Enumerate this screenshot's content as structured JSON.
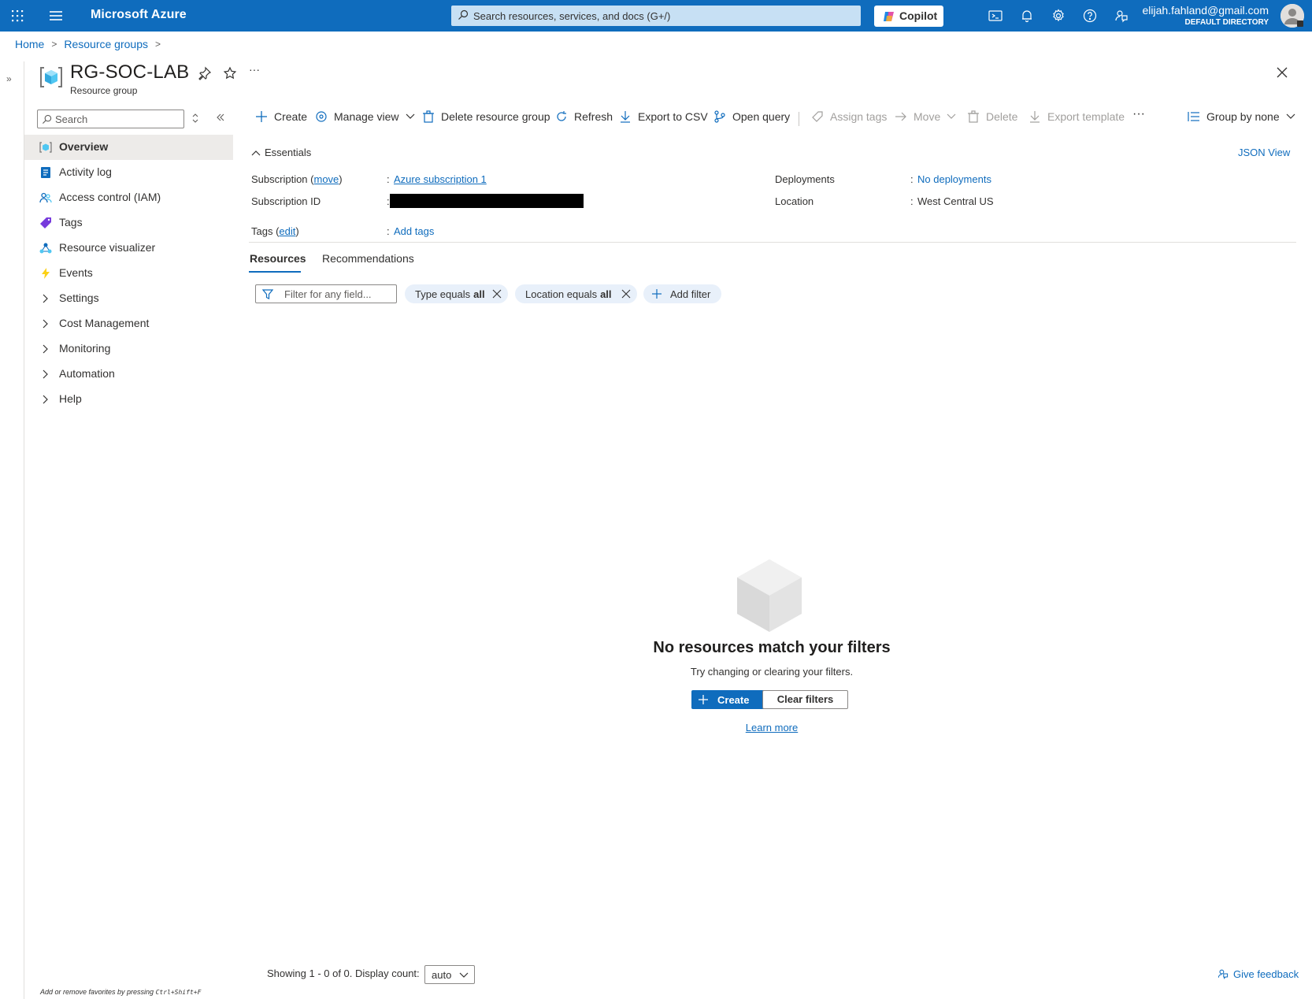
{
  "topbar": {
    "brand": "Microsoft Azure",
    "search_placeholder": "Search resources, services, and docs (G+/)",
    "copilot_label": "Copilot",
    "user_email": "elijah.fahland@gmail.com",
    "user_directory": "DEFAULT DIRECTORY",
    "icons": [
      "waffle-icon",
      "hamburger-icon",
      "cloud-shell-icon",
      "bell-icon",
      "gear-icon",
      "help-icon",
      "feedback-icon"
    ]
  },
  "breadcrumb": {
    "items": [
      "Home",
      "Resource groups"
    ]
  },
  "header": {
    "title": "RG-SOC-LAB",
    "subtitle": "Resource group",
    "more": "···"
  },
  "nav": {
    "search_placeholder": "Search",
    "items": [
      {
        "label": "Overview",
        "icon": "resource-group-icon",
        "active": true
      },
      {
        "label": "Activity log",
        "icon": "activity-log-icon"
      },
      {
        "label": "Access control (IAM)",
        "icon": "iam-icon"
      },
      {
        "label": "Tags",
        "icon": "tag-icon"
      },
      {
        "label": "Resource visualizer",
        "icon": "visualizer-icon"
      },
      {
        "label": "Events",
        "icon": "lightning-icon"
      },
      {
        "label": "Settings",
        "expandable": true
      },
      {
        "label": "Cost Management",
        "expandable": true
      },
      {
        "label": "Monitoring",
        "expandable": true
      },
      {
        "label": "Automation",
        "expandable": true
      },
      {
        "label": "Help",
        "expandable": true
      }
    ],
    "footer_text": "Add or remove favorites by pressing",
    "footer_shortcut": "Ctrl+Shift+F"
  },
  "commands": {
    "create": "Create",
    "manage_view": "Manage view",
    "delete_group": "Delete resource group",
    "refresh": "Refresh",
    "export_csv": "Export to CSV",
    "open_query": "Open query",
    "assign_tags": "Assign tags",
    "move": "Move",
    "delete": "Delete",
    "export_template": "Export template",
    "more": "···",
    "group_by": "Group by none"
  },
  "essentials": {
    "toggle_label": "Essentials",
    "json_view": "JSON View",
    "subscription_label": "Subscription (",
    "subscription_move": "move",
    "subscription_label_end": ")",
    "subscription_value": "Azure subscription 1",
    "subscription_id_label": "Subscription ID",
    "tags_label": "Tags (",
    "tags_edit": "edit",
    "tags_label_end": ")",
    "tags_value": "Add tags",
    "deployments_label": "Deployments",
    "deployments_value": "No deployments",
    "location_label": "Location",
    "location_value": "West Central US",
    "colon": ":"
  },
  "tabs": [
    "Resources",
    "Recommendations"
  ],
  "filters": {
    "placeholder": "Filter for any field...",
    "type_label": "Type equals",
    "type_value": "all",
    "location_label": "Location equals",
    "location_value": "all",
    "add_filter": "Add filter"
  },
  "empty_state": {
    "title": "No resources match your filters",
    "subtitle": "Try changing or clearing your filters.",
    "create_button": "Create",
    "clear_button": "Clear filters",
    "learn_more": "Learn more"
  },
  "footer": {
    "showing": "Showing 1 - 0 of 0. Display count:",
    "display_count": "auto",
    "give_feedback": "Give feedback"
  },
  "colors": {
    "accent": "#0f6cbd",
    "topbar": "#0f6cbd",
    "search_bg": "#c7e0f4",
    "disabled_text": "#a19f9d",
    "nav_active": "#edebe9"
  }
}
